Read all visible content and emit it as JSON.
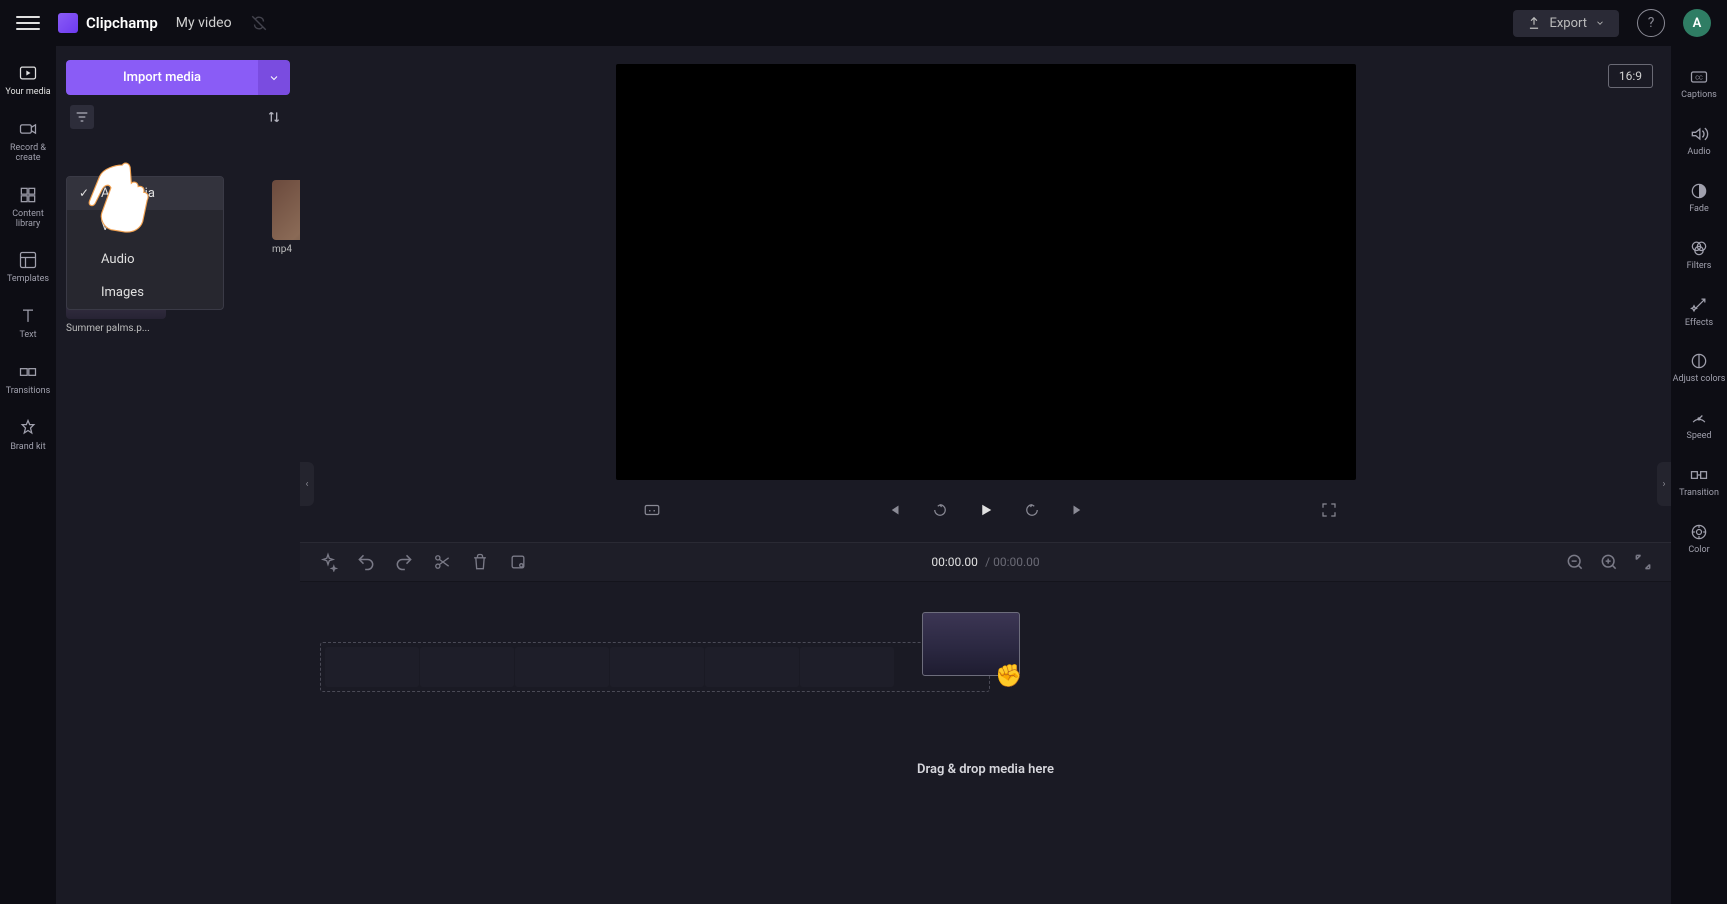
{
  "header": {
    "app_name": "Clipchamp",
    "project_title": "My video",
    "export_label": "Export"
  },
  "avatar_initial": "A",
  "nav_rail": [
    {
      "label": "Your media"
    },
    {
      "label": "Record & create"
    },
    {
      "label": "Content library"
    },
    {
      "label": "Templates"
    },
    {
      "label": "Text"
    },
    {
      "label": "Transitions"
    },
    {
      "label": "Brand kit"
    }
  ],
  "media_panel": {
    "import_label": "Import media",
    "items": [
      {
        "label": "mp4"
      },
      {
        "label": "Summer palms.p..."
      }
    ]
  },
  "filter_menu": {
    "items": [
      {
        "label": "All media",
        "active": true
      },
      {
        "label": "Video",
        "active": false
      },
      {
        "label": "Audio",
        "active": false
      },
      {
        "label": "Images",
        "active": false
      }
    ]
  },
  "preview": {
    "aspect_ratio": "16:9"
  },
  "timeline": {
    "current_time": "00:00.00",
    "total_time": "00:00.00",
    "drop_hint": "Drag & drop media here"
  },
  "right_rail": [
    {
      "label": "Captions"
    },
    {
      "label": "Audio"
    },
    {
      "label": "Fade"
    },
    {
      "label": "Filters"
    },
    {
      "label": "Effects"
    },
    {
      "label": "Adjust colors"
    },
    {
      "label": "Speed"
    },
    {
      "label": "Transition"
    },
    {
      "label": "Color"
    }
  ]
}
